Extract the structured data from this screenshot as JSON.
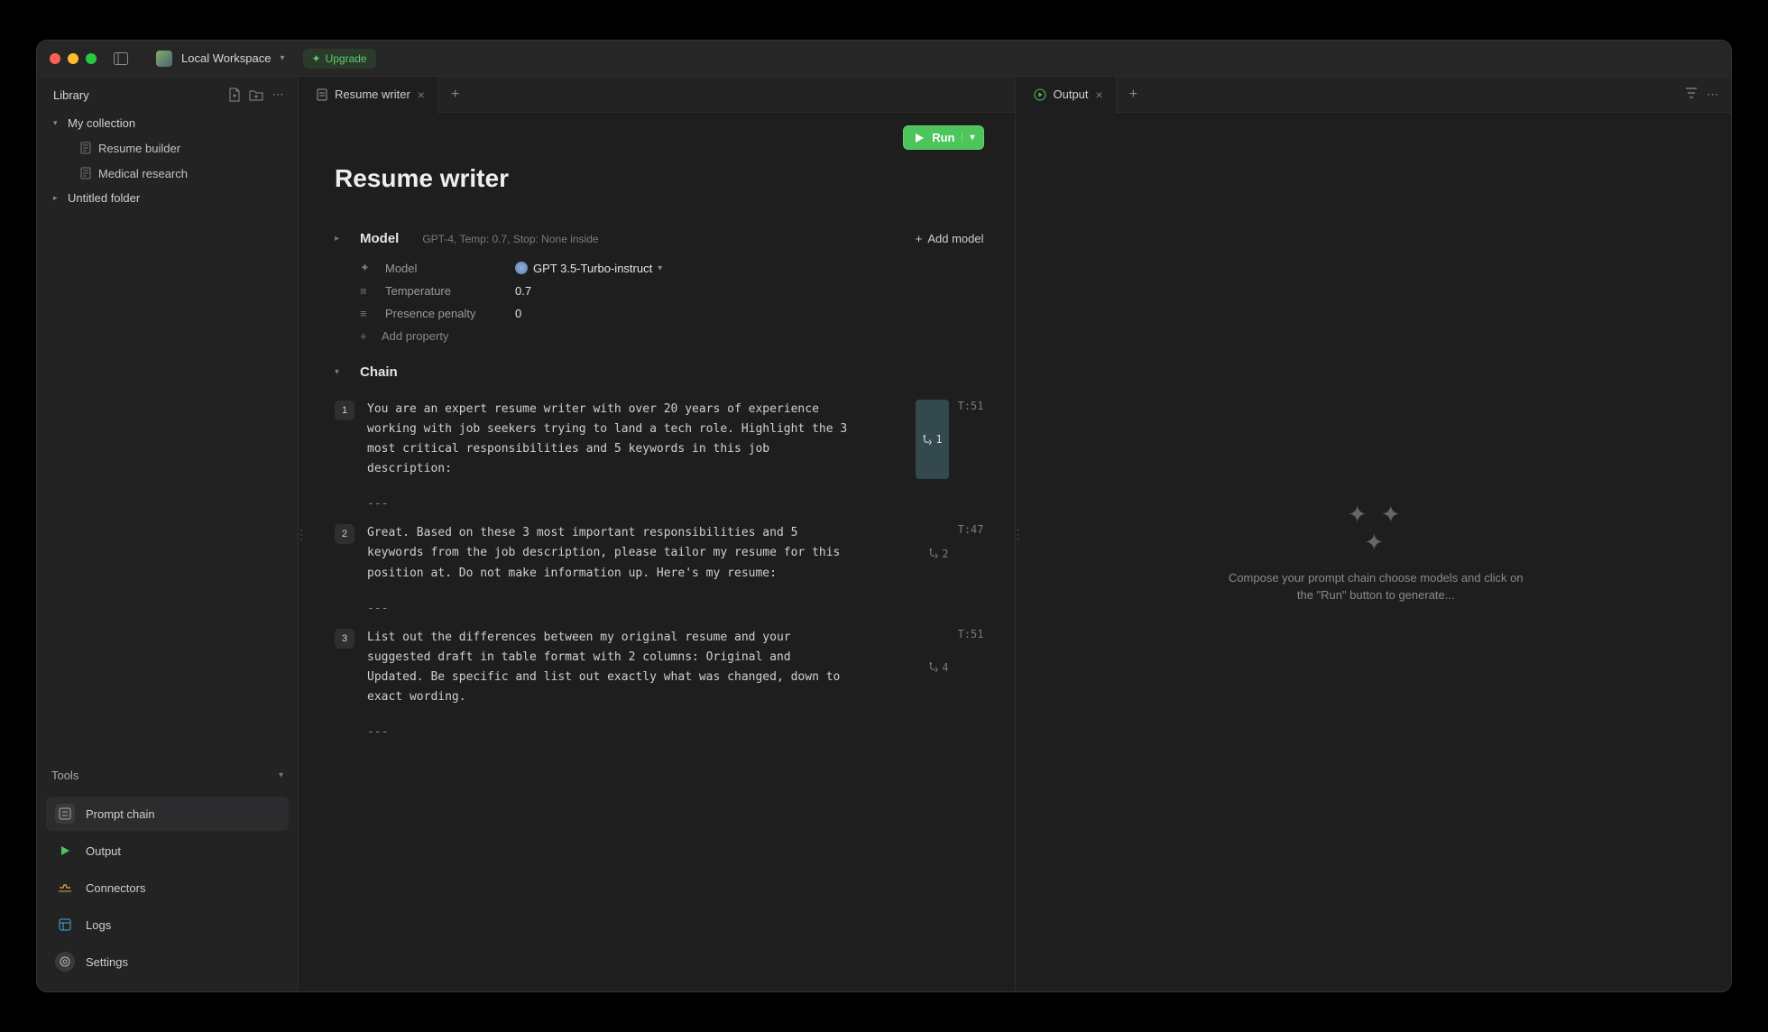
{
  "window": {
    "workspace": "Local Workspace",
    "upgrade": "Upgrade"
  },
  "sidebar": {
    "library_title": "Library",
    "tree": {
      "collection_label": "My collection",
      "items": [
        "Resume builder",
        "Medical research"
      ],
      "untitled_label": "Untitled folder"
    },
    "tools_title": "Tools",
    "tools": {
      "prompt_chain": "Prompt chain",
      "output": "Output",
      "connectors": "Connectors",
      "logs": "Logs",
      "settings": "Settings"
    }
  },
  "editor": {
    "tab_label": "Resume writer",
    "run_label": "Run",
    "title": "Resume writer",
    "model_section": {
      "title": "Model",
      "meta": "GPT-4, Temp: 0.7, Stop: None inside",
      "add_model": "Add model",
      "props": {
        "model_label": "Model",
        "model_value": "GPT 3.5-Turbo-instruct",
        "temp_label": "Temperature",
        "temp_value": "0.7",
        "presence_label": "Presence penalty",
        "presence_value": "0",
        "add_property": "Add property"
      }
    },
    "chain_section": {
      "title": "Chain",
      "sep": "---",
      "items": [
        {
          "n": "1",
          "text": "You are an expert resume writer with over 20 years of experience working with job seekers trying to land a tech role. Highlight the 3 most critical responsibilities and 5 keywords in this job description:",
          "branch": "1",
          "tokens": "T:51",
          "highlight": true
        },
        {
          "n": "2",
          "text": "Great. Based on these 3 most important responsibilities and 5 keywords from the job description, please tailor my resume for this position at. Do not make information up. Here's my resume:",
          "branch": "2",
          "tokens": "T:47",
          "highlight": false
        },
        {
          "n": "3",
          "text": "List out the differences between my original resume and your suggested draft in table format with 2 columns: Original and Updated. Be specific and list out exactly what was changed, down to exact wording.",
          "branch": "4",
          "tokens": "T:51",
          "highlight": false
        }
      ]
    }
  },
  "output": {
    "tab_label": "Output",
    "empty_text": "Compose your prompt chain choose models and click on the \"Run\" button to generate..."
  }
}
